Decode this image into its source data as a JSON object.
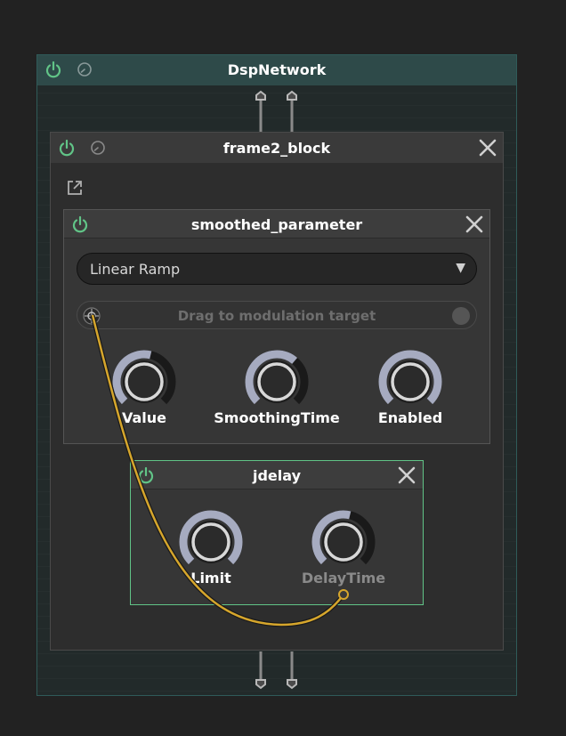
{
  "colors": {
    "accent_green": "#61c487",
    "root_header": "#2e4a49",
    "cable": "#d6a62c",
    "knob_ring": "#a6abc0"
  },
  "root": {
    "title": "DspNetwork",
    "icons": [
      "power-icon",
      "clock-icon"
    ]
  },
  "frame": {
    "title": "frame2_block",
    "icons": [
      "power-icon",
      "clock-icon",
      "popout-icon",
      "close-icon"
    ]
  },
  "smoothed": {
    "title": "smoothed_parameter",
    "mode": "Linear Ramp",
    "drag_text": "Drag to modulation target",
    "knobs": [
      {
        "label": "Value",
        "value": 0.55
      },
      {
        "label": "SmoothingTime",
        "value": 0.65
      },
      {
        "label": "Enabled",
        "value": 1.0
      }
    ]
  },
  "jdelay": {
    "title": "jdelay",
    "knobs": [
      {
        "label": "Limit",
        "value": 1.0
      },
      {
        "label": "DelayTime",
        "value": 0.55
      }
    ]
  }
}
